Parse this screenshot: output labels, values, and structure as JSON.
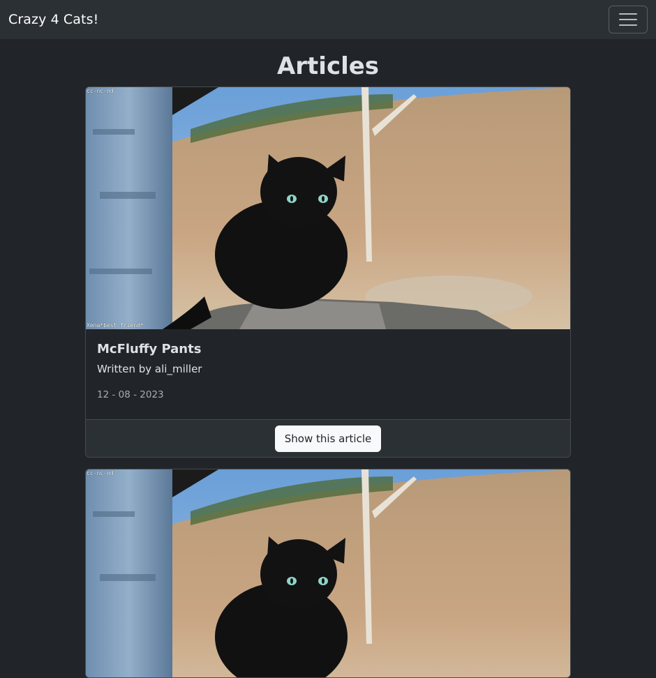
{
  "nav": {
    "brand": "Crazy 4 Cats!",
    "toggler_icon": "hamburger-menu-icon"
  },
  "page": {
    "title": "Articles"
  },
  "articles": [
    {
      "image_caption_top": "cc-nc-nd",
      "image_caption_bottom": "Xena*best friend*",
      "title": "McFluffy Pants",
      "author_line": "Written by ali_miller",
      "date": "12 - 08 - 2023",
      "button_label": "Show this article"
    },
    {
      "image_caption_top": "cc-nc-nd"
    }
  ],
  "colors": {
    "background": "#212529",
    "navbar": "#2b3035",
    "border": "#464b51",
    "button_bg": "#f8f9fa"
  }
}
